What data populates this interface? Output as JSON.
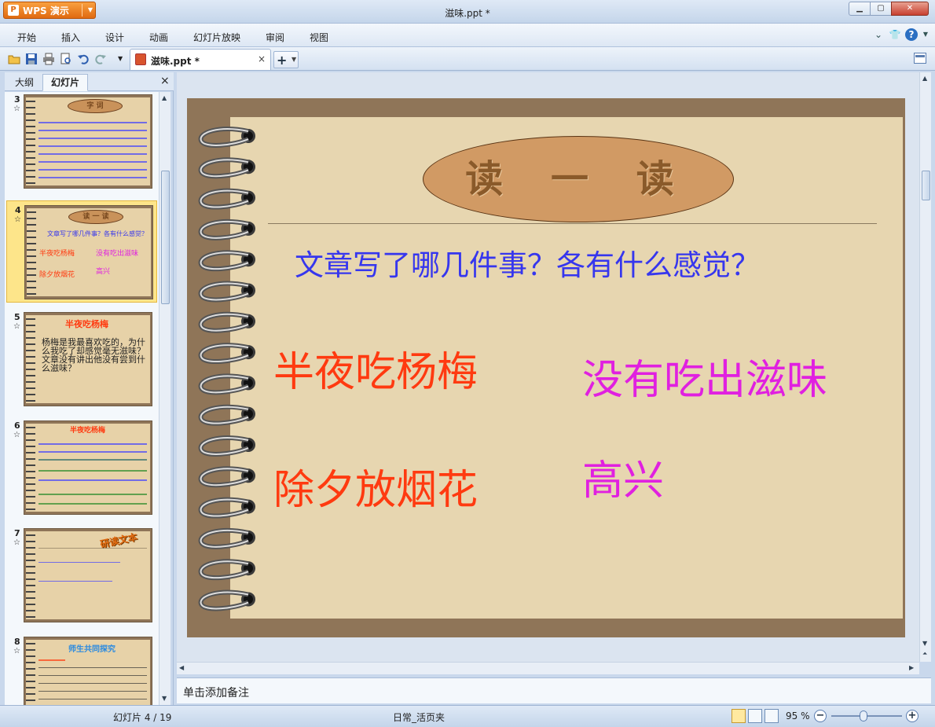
{
  "window": {
    "title": "滋味.ppt *",
    "app_button": "WPS 演示"
  },
  "menu": [
    "开始",
    "插入",
    "设计",
    "动画",
    "幻灯片放映",
    "审阅",
    "视图"
  ],
  "doc_tab": {
    "label": "滋味.ppt *",
    "close": "×"
  },
  "panel": {
    "tab_outline": "大纲",
    "tab_slides": "幻灯片",
    "close": "×"
  },
  "thumbnails": [
    {
      "num": "3",
      "title": "字 词"
    },
    {
      "num": "4",
      "title": "读 一 读",
      "q": "文章写了哪几件事？各有什么感觉？",
      "a": "半夜吃杨梅",
      "b": "没有吃出滋味",
      "c": "除夕放烟花",
      "d": "高兴"
    },
    {
      "num": "5",
      "title": "半夜吃杨梅",
      "body": "杨梅是我最喜欢吃的，为什么我吃了却感觉毫无滋味？文章没有讲出他没有尝到什么滋味？"
    },
    {
      "num": "6",
      "title": "半夜吃杨梅"
    },
    {
      "num": "7",
      "title": "研读文本"
    },
    {
      "num": "8",
      "title": "师生共同探究"
    }
  ],
  "slide": {
    "title": "读 一 读",
    "question": "文章写了哪几件事？各有什么感觉？",
    "event1": "半夜吃杨梅",
    "feeling1": "没有吃出滋味",
    "event2": "除夕放烟花",
    "feeling2": "高兴"
  },
  "notes_placeholder": "单击添加备注",
  "status": {
    "slide_pos": "幻灯片 4 / 19",
    "template": "日常_活页夹",
    "zoom": "95 %"
  },
  "colors": {
    "accent": "#e06a10",
    "question": "#3636ee",
    "event": "#ff3a10",
    "feeling": "#e020e0"
  }
}
